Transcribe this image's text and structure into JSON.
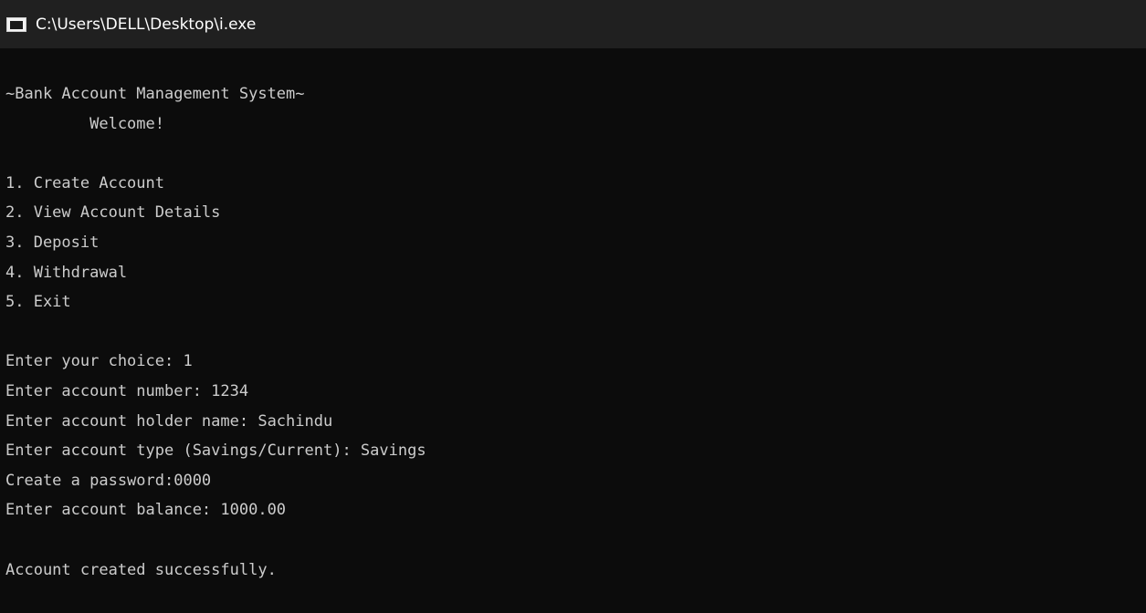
{
  "window": {
    "title": "C:\\Users\\DELL\\Desktop\\i.exe",
    "icon": "console-app-icon"
  },
  "console": {
    "lines": [
      "~Bank Account Management System~",
      "         Welcome!",
      "",
      "1. Create Account",
      "2. View Account Details",
      "3. Deposit",
      "4. Withdrawal",
      "5. Exit",
      "",
      "Enter your choice: 1",
      "Enter account number: 1234",
      "Enter account holder name: Sachindu",
      "Enter account type (Savings/Current): Savings",
      "Create a password:0000",
      "Enter account balance: 1000.00",
      "",
      "Account created successfully."
    ]
  },
  "colors": {
    "titlebar": "#202020",
    "background": "#0c0c0c",
    "text": "#cccccc",
    "title_text": "#ffffff"
  }
}
